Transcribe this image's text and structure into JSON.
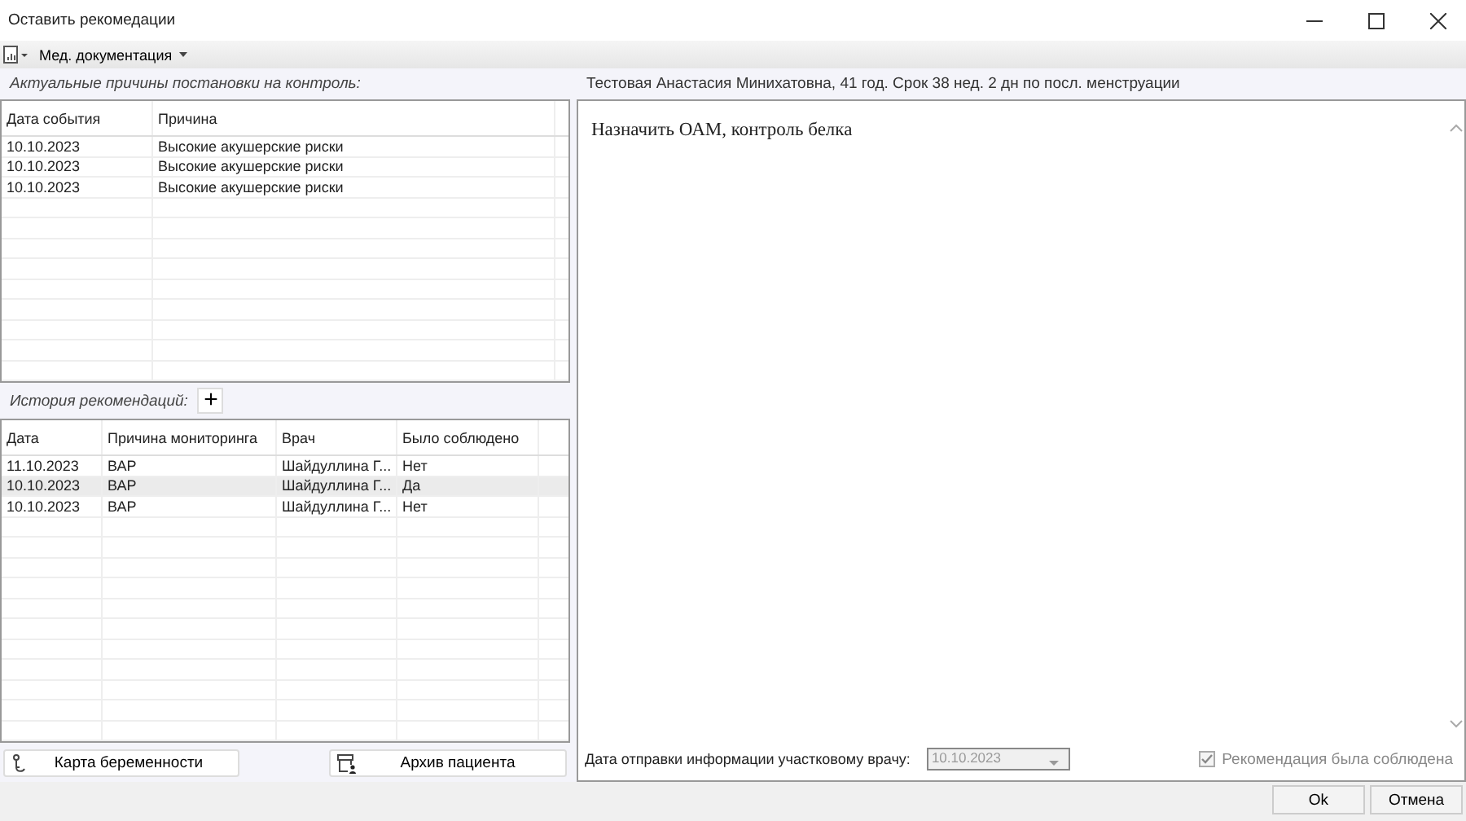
{
  "window": {
    "title": "Оставить рекомедации"
  },
  "toolbar": {
    "menu": "Мед. документация"
  },
  "reasons": {
    "label": "Актуальные причины постановки на контроль:",
    "columns": [
      "Дата события",
      "Причина"
    ],
    "rows": [
      [
        "10.10.2023",
        "Высокие акушерские риски"
      ],
      [
        "10.10.2023",
        "Высокие акушерские риски"
      ],
      [
        "10.10.2023",
        "Высокие акушерские риски"
      ]
    ]
  },
  "history": {
    "label": "История рекомендаций:",
    "add_button": "+",
    "columns": [
      "Дата",
      "Причина мониторинга",
      "Врач",
      "Было соблюдено"
    ],
    "rows": [
      {
        "cells": [
          "11.10.2023",
          "ВАР",
          "Шайдуллина Г...",
          "Нет"
        ],
        "selected": false
      },
      {
        "cells": [
          "10.10.2023",
          "ВАР",
          "Шайдуллина Г...",
          "Да"
        ],
        "selected": true
      },
      {
        "cells": [
          "10.10.2023",
          "ВАР",
          "Шайдуллина Г...",
          "Нет"
        ],
        "selected": false
      }
    ]
  },
  "left_buttons": [
    "Карта беременности",
    "Архив пациента"
  ],
  "patient": "Тестовая Анастасия Минихатовна, 41 год. Срок 38 нед. 2 дн по посл. менструации",
  "recommendation_text": "Назначить ОАМ, контроль белка",
  "send_date": {
    "label": "Дата отправки информации участковому врачу:",
    "value": "10.10.2023",
    "disabled": true
  },
  "complied": {
    "label": "Рекомендация была соблюдена",
    "checked": true,
    "disabled": true
  },
  "buttons": [
    "Ok",
    "Отмена"
  ]
}
